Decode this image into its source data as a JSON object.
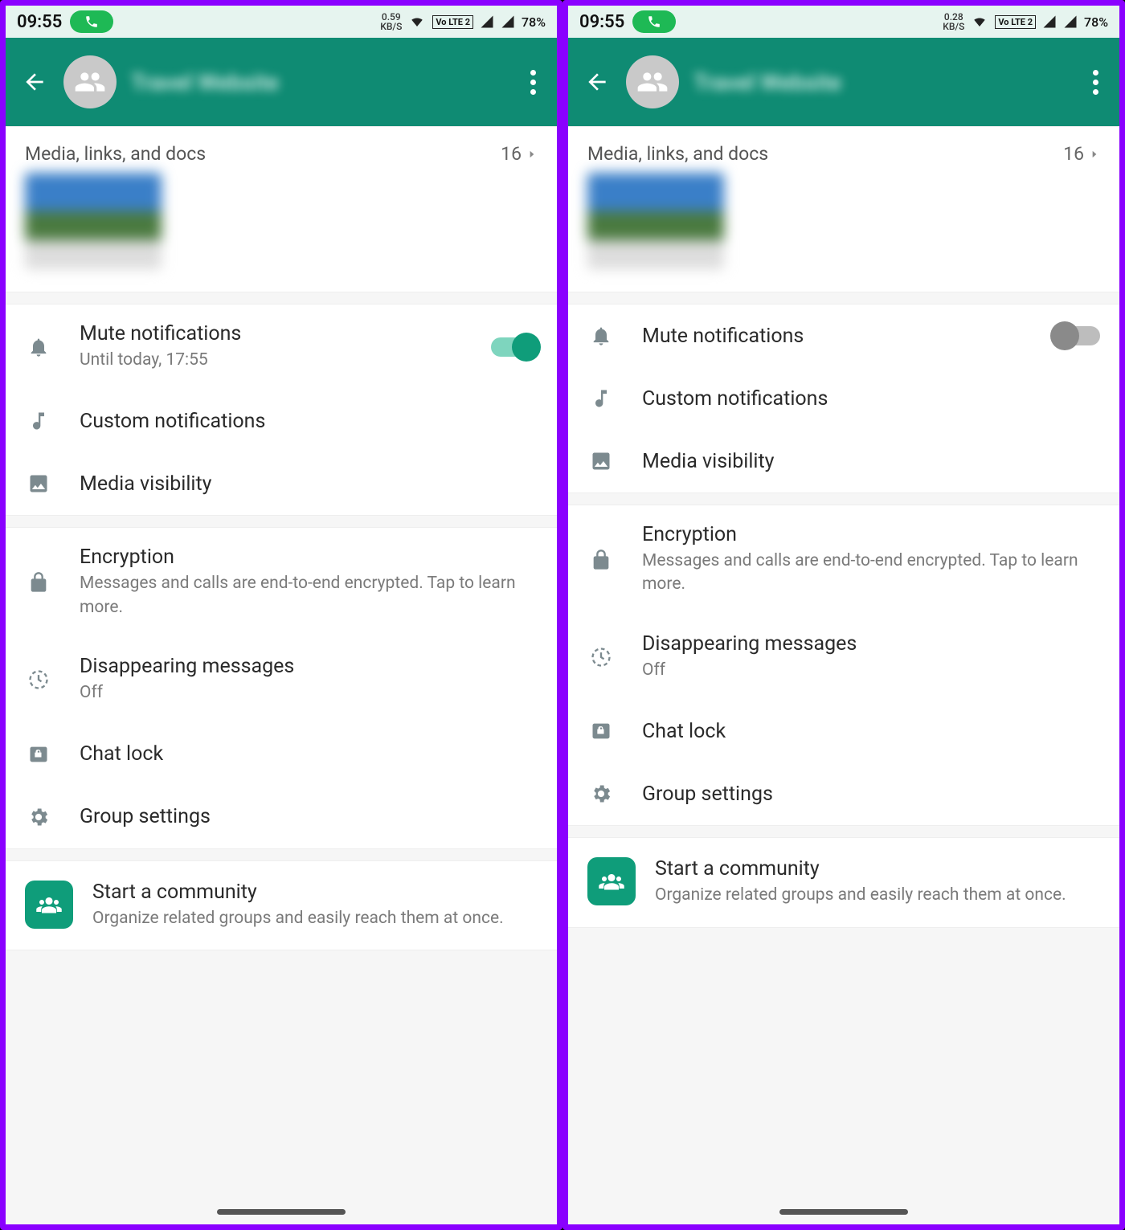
{
  "left": {
    "status": {
      "time": "09:55",
      "kbs": "0.59",
      "kbs_unit": "KB/S",
      "battery": "78%",
      "net": "Vo LTE 2"
    },
    "header": {
      "title": "Travel Website"
    },
    "media": {
      "label": "Media, links, and docs",
      "count": "16"
    },
    "settings": {
      "mute": {
        "title": "Mute notifications",
        "sub": "Until today, 17:55"
      },
      "custom": {
        "title": "Custom notifications"
      },
      "mediavis": {
        "title": "Media visibility"
      },
      "encryption": {
        "title": "Encryption",
        "sub": "Messages and calls are end-to-end encrypted. Tap to learn more."
      },
      "disappearing": {
        "title": "Disappearing messages",
        "sub": "Off"
      },
      "chatlock": {
        "title": "Chat lock"
      },
      "groupsettings": {
        "title": "Group settings"
      }
    },
    "community": {
      "title": "Start a community",
      "sub": "Organize related groups and easily reach them at once."
    }
  },
  "right": {
    "status": {
      "time": "09:55",
      "kbs": "0.28",
      "kbs_unit": "KB/S",
      "battery": "78%",
      "net": "Vo LTE 2"
    },
    "header": {
      "title": "Travel Website"
    },
    "media": {
      "label": "Media, links, and docs",
      "count": "16"
    },
    "settings": {
      "mute": {
        "title": "Mute notifications"
      },
      "custom": {
        "title": "Custom notifications"
      },
      "mediavis": {
        "title": "Media visibility"
      },
      "encryption": {
        "title": "Encryption",
        "sub": "Messages and calls are end-to-end encrypted. Tap to learn more."
      },
      "disappearing": {
        "title": "Disappearing messages",
        "sub": "Off"
      },
      "chatlock": {
        "title": "Chat lock"
      },
      "groupsettings": {
        "title": "Group settings"
      }
    },
    "community": {
      "title": "Start a community",
      "sub": "Organize related groups and easily reach them at once."
    }
  }
}
